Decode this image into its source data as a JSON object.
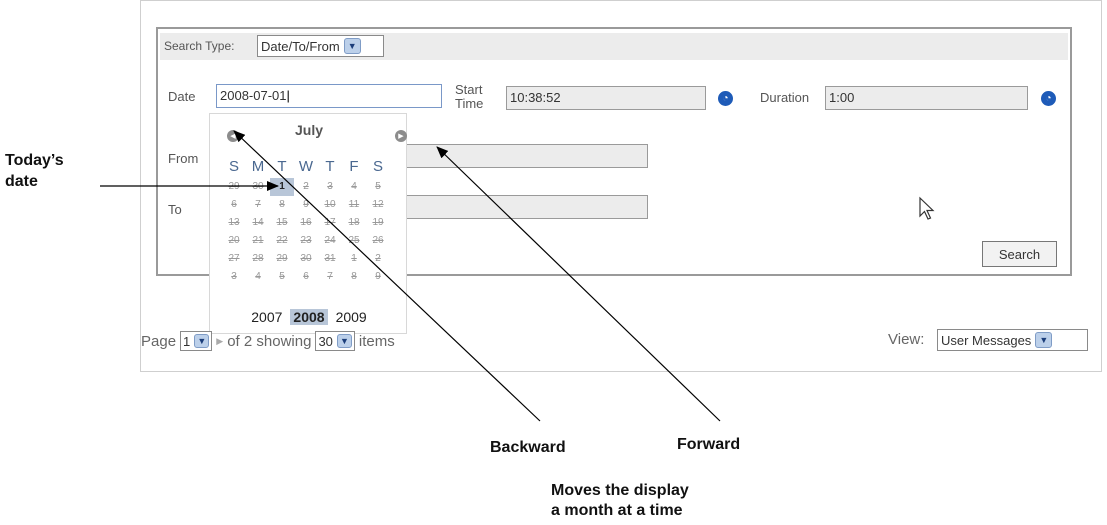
{
  "search_type": {
    "label": "Search Type:",
    "value": "Date/To/From"
  },
  "date": {
    "label": "Date",
    "value": "2008-07-01"
  },
  "start_time": {
    "label_line1": "Start",
    "label_line2": "Time",
    "value": "10:38:52"
  },
  "duration": {
    "label": "Duration",
    "value": "1:00"
  },
  "from": {
    "label": "From"
  },
  "to": {
    "label": "To"
  },
  "search_button": "Search",
  "calendar": {
    "month": "July",
    "weekdays": [
      "S",
      "M",
      "T",
      "W",
      "T",
      "F",
      "S"
    ],
    "weeks": [
      [
        "29",
        "30",
        "1",
        "2",
        "3",
        "4",
        "5"
      ],
      [
        "6",
        "7",
        "8",
        "9",
        "10",
        "11",
        "12"
      ],
      [
        "13",
        "14",
        "15",
        "16",
        "17",
        "18",
        "19"
      ],
      [
        "20",
        "21",
        "22",
        "23",
        "24",
        "25",
        "26"
      ],
      [
        "27",
        "28",
        "29",
        "30",
        "31",
        "1",
        "2"
      ],
      [
        "3",
        "4",
        "5",
        "6",
        "7",
        "8",
        "9"
      ]
    ],
    "years": [
      "2007",
      "2008",
      "2009"
    ],
    "current_year": "2008"
  },
  "pager": {
    "prefix": "Page",
    "page": "1",
    "of_text": "of 2 showing",
    "per_page": "30",
    "suffix": "items"
  },
  "view": {
    "label": "View:",
    "value": "User Messages"
  },
  "annotations": {
    "todays_date_line1": "Today’s",
    "todays_date_line2": "date",
    "backward": "Backward",
    "forward": "Forward",
    "moves_line1": "Moves the display",
    "moves_line2": "a month at a time"
  },
  "icons": {
    "clock": "clock-icon",
    "dropdown": "chevron-down-icon",
    "prev": "prev-month-icon",
    "next": "next-month-icon",
    "cursor": "mouse-cursor-icon"
  }
}
